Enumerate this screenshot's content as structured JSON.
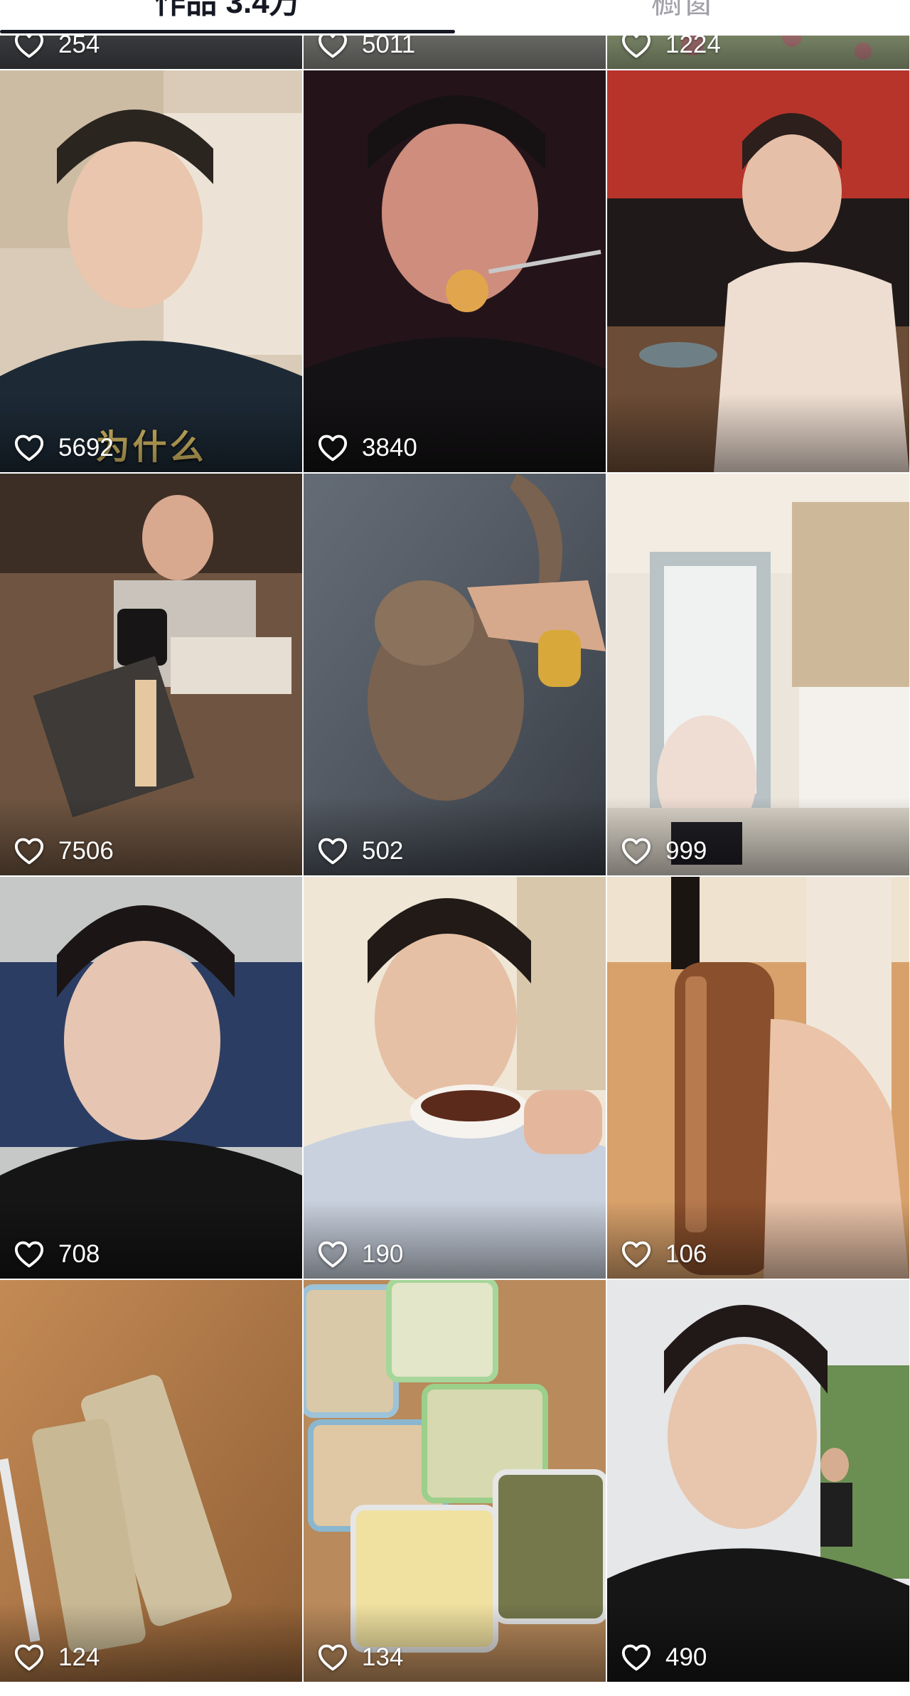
{
  "tabs": [
    {
      "label": "作品 3.4万",
      "active": true
    },
    {
      "label": "橱窗",
      "active": false
    }
  ],
  "colors": {
    "tab_active": "#161823",
    "tab_inactive": "#a0a0a8",
    "like_text": "#ffffff",
    "caption": "#e3c66a"
  },
  "icons": {
    "like": "heart-outline-icon"
  },
  "videos": [
    {
      "likes": "254"
    },
    {
      "likes": "5011"
    },
    {
      "likes": "1224"
    },
    {
      "likes": "5692",
      "caption": "为什么"
    },
    {
      "likes": "3840"
    },
    {
      "likes": "",
      "likes_alt": ""
    },
    {
      "likes": "7506"
    },
    {
      "likes": "502"
    },
    {
      "likes": "999"
    },
    {
      "likes": "708"
    },
    {
      "likes": "190"
    },
    {
      "likes": "106"
    },
    {
      "likes": "124"
    },
    {
      "likes": "134"
    },
    {
      "likes": "490"
    }
  ]
}
